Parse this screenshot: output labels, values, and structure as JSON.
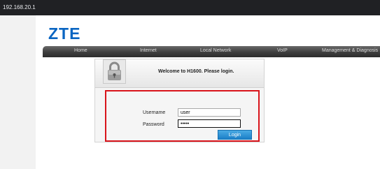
{
  "browser": {
    "url": "192.168.20.1"
  },
  "brand": {
    "logo": "ZTE",
    "color": "#0a65c2"
  },
  "nav": [
    "Home",
    "Internet",
    "Local Network",
    "VoIP",
    "Management & Diagnosis"
  ],
  "login": {
    "welcome": "Welcome to H1600.  Please login.",
    "username_label": "Username",
    "username_value": "user",
    "password_label": "Password",
    "password_value": "•••••",
    "button": "Login",
    "lock_icon": "padlock-icon",
    "highlight_color": "#d9141b"
  }
}
